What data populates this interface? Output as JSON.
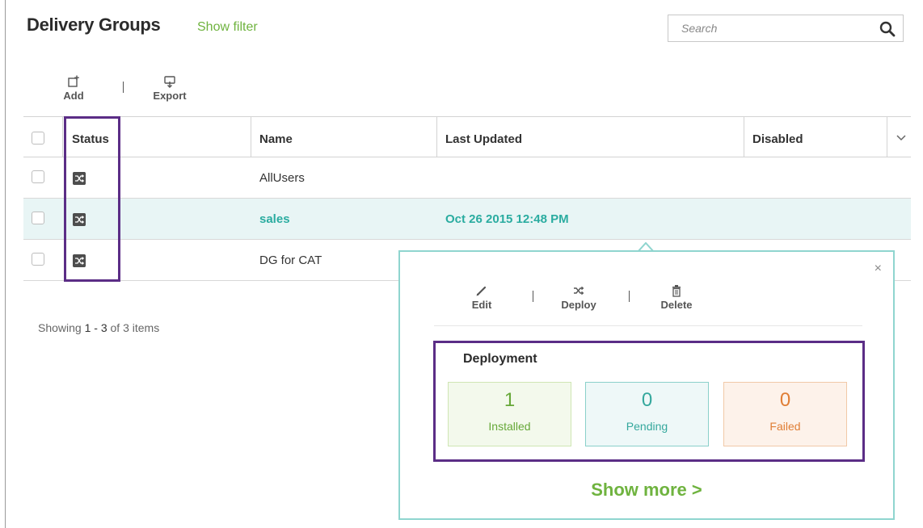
{
  "page": {
    "title": "Delivery Groups",
    "show_filter": "Show filter"
  },
  "search": {
    "placeholder": "Search"
  },
  "toolbar": {
    "add_label": "Add",
    "export_label": "Export"
  },
  "table": {
    "columns": {
      "status": "Status",
      "name": "Name",
      "last_updated": "Last Updated",
      "disabled": "Disabled"
    },
    "rows": [
      {
        "name": "AllUsers",
        "last_updated": "",
        "disabled": ""
      },
      {
        "name": "sales",
        "last_updated": "Oct 26 2015 12:48 PM",
        "disabled": ""
      },
      {
        "name": "DG for CAT",
        "last_updated": "",
        "disabled": ""
      }
    ]
  },
  "pager": {
    "prefix": "Showing",
    "range": "1 - 3",
    "suffix": "of 3 items"
  },
  "popover": {
    "close": "×",
    "edit_label": "Edit",
    "deploy_label": "Deploy",
    "delete_label": "Delete",
    "deployment_title": "Deployment",
    "installed": {
      "count": "1",
      "label": "Installed"
    },
    "pending": {
      "count": "0",
      "label": "Pending"
    },
    "failed": {
      "count": "0",
      "label": "Failed"
    },
    "show_more": "Show more >"
  },
  "colors": {
    "accent_green": "#6fb33f",
    "accent_teal": "#2aaca0",
    "failed_orange": "#e07e35",
    "highlight_purple": "#5b2d86"
  },
  "icons": {
    "search": "search-icon",
    "add": "add-icon",
    "export": "export-icon",
    "status": "shuffle-icon",
    "edit": "pencil-icon",
    "deploy": "shuffle-icon",
    "delete": "trash-icon",
    "close": "close-icon",
    "column_menu": "chevron-down-icon"
  }
}
